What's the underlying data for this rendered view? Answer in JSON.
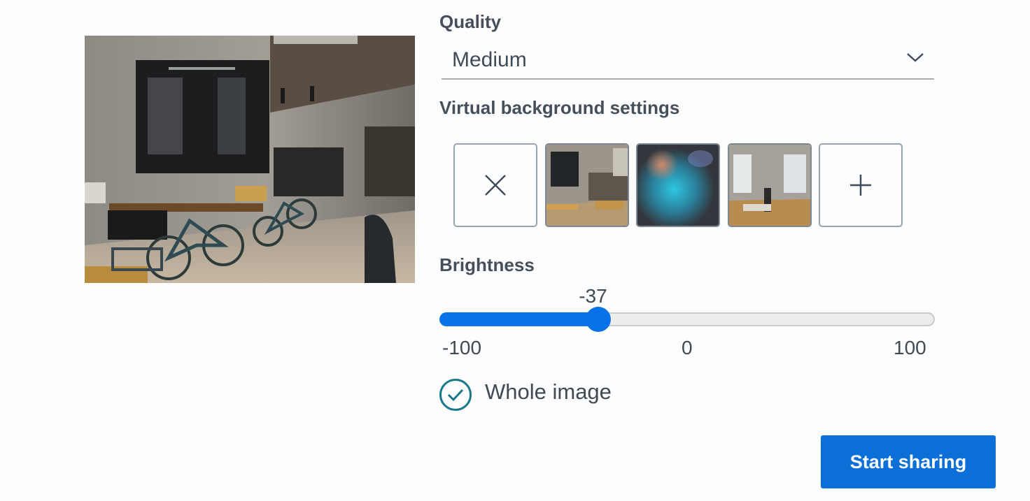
{
  "quality": {
    "label": "Quality",
    "selected": "Medium"
  },
  "virtual_background": {
    "label": "Virtual background settings",
    "options": [
      {
        "name": "none",
        "icon": "close-icon"
      },
      {
        "name": "cafe",
        "icon": "image"
      },
      {
        "name": "blur",
        "icon": "image"
      },
      {
        "name": "office",
        "icon": "image"
      },
      {
        "name": "add",
        "icon": "plus-icon"
      }
    ]
  },
  "brightness": {
    "label": "Brightness",
    "value": -37,
    "min_label": "-100",
    "mid_label": "0",
    "max_label": "100",
    "min": -100,
    "max": 100
  },
  "whole_image": {
    "label": "Whole image",
    "checked": true
  },
  "actions": {
    "start_label": "Start sharing"
  },
  "colors": {
    "accent": "#0a72e8",
    "button": "#0c6fd8",
    "check": "#17798a"
  }
}
